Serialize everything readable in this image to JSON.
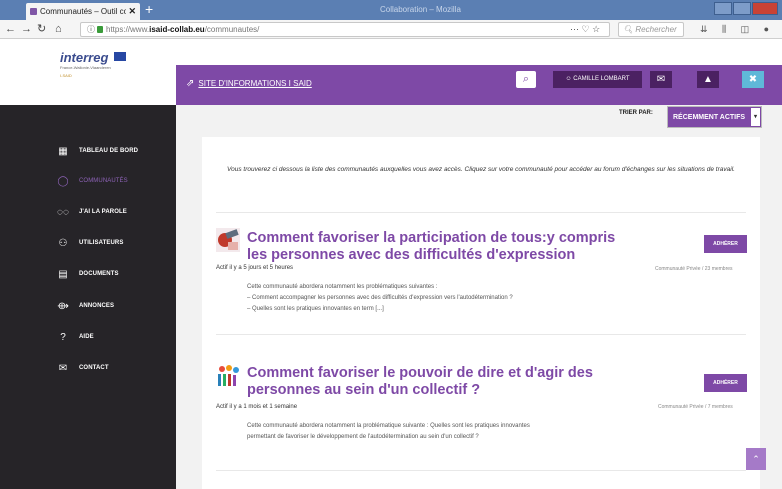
{
  "browser": {
    "tab_title": "Communautés – Outil collabo",
    "tab_close": "✕",
    "new_tab": "+",
    "window_title": "Collaboration – Mozilla",
    "url_prefix": "https://www.",
    "url_domain": "isaid-collab.eu",
    "url_path": "/communautes/",
    "url_icons": "⋯ ♡ ☆",
    "search_placeholder": "Rechercher",
    "toolbar_icons": "⇊ ⫼ ◫ ● ◆"
  },
  "logo": {
    "name": "interreg",
    "subtitle": "France-Wallonie-Vlaanderen",
    "project": "I-SAID"
  },
  "header": {
    "site_link": "SITE D'INFORMATIONS I SAID",
    "user_name": "CAMILLE LOMBART"
  },
  "sidebar": {
    "items": [
      {
        "label": "TABLEAU DE BORD",
        "icon": "▦"
      },
      {
        "label": "COMMUNAUTÉS",
        "icon": "◯"
      },
      {
        "label": "J'AI LA PAROLE",
        "icon": "◌◌"
      },
      {
        "label": "UTILISATEURS",
        "icon": "⚇"
      },
      {
        "label": "DOCUMENTS",
        "icon": "▤"
      },
      {
        "label": "ANNONCES",
        "icon": "⟴"
      },
      {
        "label": "AIDE",
        "icon": "?"
      },
      {
        "label": "CONTACT",
        "icon": "✉"
      }
    ]
  },
  "sort": {
    "label": "TRIER PAR:",
    "selected": "RÉCEMMENT ACTIFS",
    "caret": "▾"
  },
  "intro": "Vous trouverez ci dessous la liste des communautés auxquelles vous avez accès. Cliquez sur votre communauté pour accéder au forum d'échanges sur les situations de travail.",
  "communities": [
    {
      "title": "Comment favoriser la participation de tous:y compris les personnes avec des difficultés d'expression",
      "activity": "Actif il y a 5 jours et 5 heures",
      "desc_lines": [
        "Cette communauté abordera notamment les problématiques suivantes :",
        "– Comment accompagner les personnes avec des difficultés d'expression vers l'autodétermination ?",
        "– Quelles sont les pratiques innovantes en term [...]"
      ],
      "join": "ADHÉRER",
      "type": "Communauté Privée / 23 membres"
    },
    {
      "title": "Comment favoriser le pouvoir de dire et d'agir des personnes au sein d'un collectif ?",
      "activity": "Actif il y a 1 mois et 1 semaine",
      "desc_lines": [
        "Cette communauté abordera notamment la problématique suivante : Quelles sont les pratiques innovantes",
        "permettant de favoriser le développement de l'autodétermination au sein d'un collectif ?"
      ],
      "join": "ADHÉRER",
      "type": "Communauté Privée / 7 membres"
    }
  ],
  "scroll_top_icon": "⌃",
  "colors": {
    "brand_purple": "#7e49a6",
    "dark_purple": "#4b2162",
    "sidebar_bg": "#262428"
  }
}
